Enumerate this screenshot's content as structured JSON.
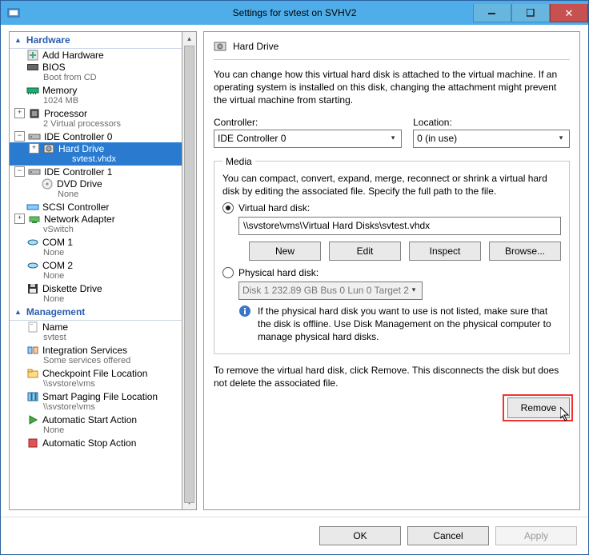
{
  "window": {
    "title": "Settings for svtest on SVHV2"
  },
  "sections": {
    "hardware": "Hardware",
    "management": "Management"
  },
  "tree": {
    "add_hardware": "Add Hardware",
    "bios": {
      "label": "BIOS",
      "sub": "Boot from CD"
    },
    "memory": {
      "label": "Memory",
      "sub": "1024 MB"
    },
    "processor": {
      "label": "Processor",
      "sub": "2 Virtual processors"
    },
    "ide0": {
      "label": "IDE Controller 0"
    },
    "hard_drive": {
      "label": "Hard Drive",
      "sub": "svtest.vhdx"
    },
    "ide1": {
      "label": "IDE Controller 1"
    },
    "dvd": {
      "label": "DVD Drive",
      "sub": "None"
    },
    "scsi": {
      "label": "SCSI Controller"
    },
    "net": {
      "label": "Network Adapter",
      "sub": "vSwitch"
    },
    "com1": {
      "label": "COM 1",
      "sub": "None"
    },
    "com2": {
      "label": "COM 2",
      "sub": "None"
    },
    "diskette": {
      "label": "Diskette Drive",
      "sub": "None"
    },
    "name": {
      "label": "Name",
      "sub": "svtest"
    },
    "integ": {
      "label": "Integration Services",
      "sub": "Some services offered"
    },
    "checkpoint": {
      "label": "Checkpoint File Location",
      "sub": "\\\\svstore\\vms"
    },
    "paging": {
      "label": "Smart Paging File Location",
      "sub": "\\\\svstore\\vms"
    },
    "autostart": {
      "label": "Automatic Start Action",
      "sub": "None"
    },
    "autostop": {
      "label": "Automatic Stop Action"
    }
  },
  "pane": {
    "title": "Hard Drive",
    "intro": "You can change how this virtual hard disk is attached to the virtual machine. If an operating system is installed on this disk, changing the attachment might prevent the virtual machine from starting.",
    "controller_label": "Controller:",
    "controller_value": "IDE Controller 0",
    "location_label": "Location:",
    "location_value": "0 (in use)",
    "media_legend": "Media",
    "media_intro": "You can compact, convert, expand, merge, reconnect or shrink a virtual hard disk by editing the associated file. Specify the full path to the file.",
    "radio_vhd": "Virtual hard disk:",
    "vhd_path": "\\\\svstore\\vms\\Virtual Hard Disks\\svtest.vhdx",
    "btn_new": "New",
    "btn_edit": "Edit",
    "btn_inspect": "Inspect",
    "btn_browse": "Browse...",
    "radio_phys": "Physical hard disk:",
    "phys_value": "Disk 1 232.89 GB Bus 0 Lun 0 Target 2",
    "phys_info": "If the physical hard disk you want to use is not listed, make sure that the disk is offline. Use Disk Management on the physical computer to manage physical hard disks.",
    "remove_text": "To remove the virtual hard disk, click Remove. This disconnects the disk but does not delete the associated file.",
    "btn_remove": "Remove"
  },
  "footer": {
    "ok": "OK",
    "cancel": "Cancel",
    "apply": "Apply"
  }
}
